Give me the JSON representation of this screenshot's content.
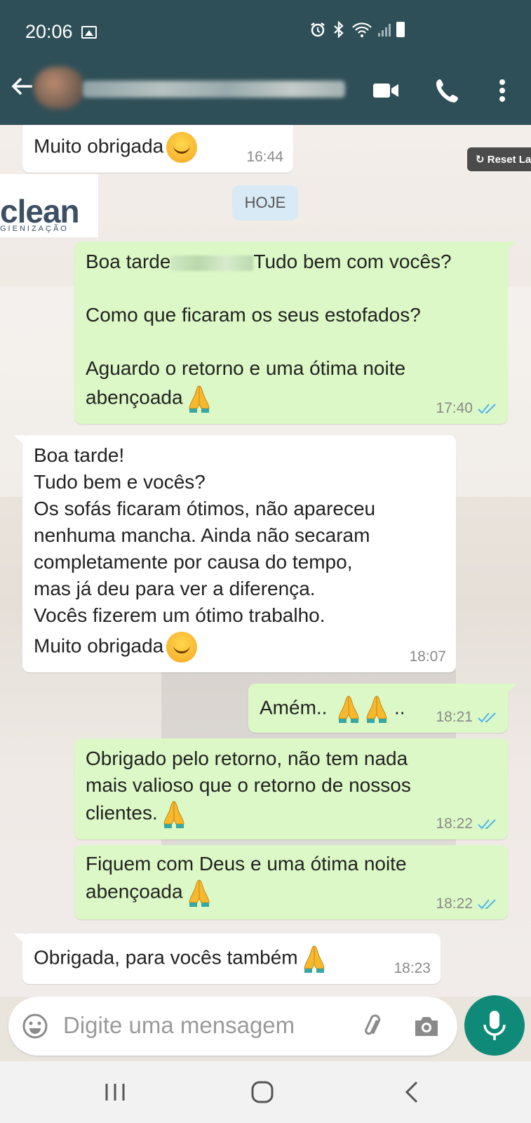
{
  "status_bar": {
    "time": "20:06"
  },
  "header": {
    "back_icon": "arrow-left-icon",
    "video_icon": "video-call-icon",
    "call_icon": "phone-icon",
    "menu_icon": "more-vert-icon"
  },
  "background": {
    "logo_text": "clean",
    "logo_sub": "GIENIZAÇÃO",
    "reset_chip": "Reset La"
  },
  "date_chip": "HOJE",
  "messages": [
    {
      "dir": "in",
      "text": "Muito obrigada",
      "emoji": "smile",
      "time": "16:44"
    },
    {
      "dir": "out",
      "text_a": "Boa tarde",
      "text_b": "Tudo bem com vocês?",
      "text_c": "Como que ficaram os seus estofados?",
      "text_d": "Aguardo o retorno e uma ótima noite",
      "text_e": "abençoada",
      "emoji": "pray",
      "time": "17:40",
      "read": true
    },
    {
      "dir": "in",
      "text": "Boa tarde!\nTudo bem e vocês?\nOs sofás ficaram ótimos, não apareceu\nnenhuma mancha. Ainda não secaram\ncompletamente por causa do tempo,\nmas já deu para ver a diferença.\nVocês fizerem um ótimo trabalho.",
      "text_last": "Muito obrigada",
      "emoji": "smile",
      "time": "18:07"
    },
    {
      "dir": "out",
      "text": "Amém..",
      "text_tail": "..",
      "emoji": "pray-pray",
      "time": "18:21",
      "read": true
    },
    {
      "dir": "out",
      "text": "Obrigado pelo retorno, não tem nada\nmais valioso que o retorno de nossos\nclientes.",
      "emoji": "pray",
      "time": "18:22",
      "read": true
    },
    {
      "dir": "out",
      "text": "Fiquem com Deus e uma ótima noite\nabençoada",
      "emoji": "pray",
      "time": "18:22",
      "read": true
    },
    {
      "dir": "in",
      "text": "Obrigada, para vocês também",
      "emoji": "pray",
      "time": "18:23"
    }
  ],
  "composer": {
    "placeholder": "Digite uma mensagem",
    "emoji_icon": "emoji-icon",
    "attach_icon": "paperclip-icon",
    "camera_icon": "camera-icon",
    "mic_icon": "mic-icon"
  },
  "nav": {
    "recents_icon": "recents-icon",
    "home_icon": "home-icon",
    "back_icon": "back-chevron-icon"
  },
  "colors": {
    "header": "#2f4f58",
    "outgoing": "#dcf8c6",
    "incoming": "#ffffff",
    "read_ticks": "#4fb6ec",
    "mic": "#0f8a78"
  }
}
